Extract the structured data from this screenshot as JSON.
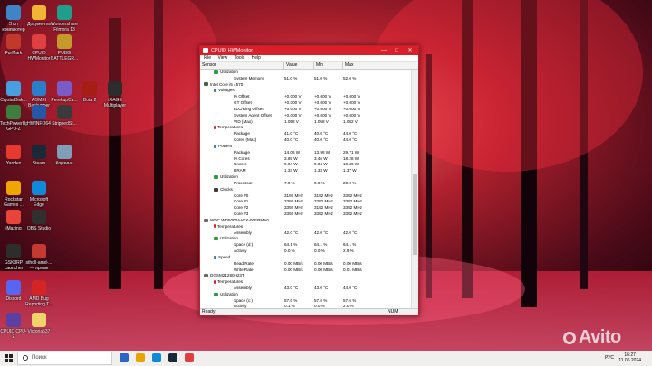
{
  "desktop_icons": [
    {
      "label": "Этот компьютер",
      "color": "#3d85c6"
    },
    {
      "label": "Документы",
      "color": "#f2b533"
    },
    {
      "label": "Wondershare Filmora 13",
      "color": "#1f9e8b"
    },
    {
      "label": "FurMark",
      "color": "#c0392b"
    },
    {
      "label": "CPUID HWMonitor",
      "color": "#e04040"
    },
    {
      "label": "PUBG BATTLEGR...",
      "color": "#c49a2b"
    },
    {
      "label": "CrystalDisk...",
      "color": "#46a0e0"
    },
    {
      "label": "AOMEI Backupper",
      "color": "#2a7fcc"
    },
    {
      "label": "PerekupCa...",
      "color": "#7b5cc7"
    },
    {
      "label": "Dota 2",
      "color": "#a61d16"
    },
    {
      "label": "tRAGE Multiplayer",
      "color": "#2d2d2d"
    },
    {
      "label": "TechPowerUp GPU-Z",
      "color": "#3e7d3e"
    },
    {
      "label": "HWINFO64",
      "color": "#2457a8"
    },
    {
      "label": "StrippedSt...",
      "color": "#3a3a3a"
    },
    {
      "label": "Yandex",
      "color": "#e63a2e"
    },
    {
      "label": "Steam",
      "color": "#1b2838"
    },
    {
      "label": "Корзина",
      "color": "#7f9eb8"
    },
    {
      "label": "Rockstar Games ...",
      "color": "#f0a500"
    },
    {
      "label": "Microsoft Edge",
      "color": "#0f8ad8"
    },
    {
      "label": "iMazing",
      "color": "#e8443a"
    },
    {
      "label": "OBS Studio",
      "color": "#303030"
    },
    {
      "label": "GSK3RP Launcher",
      "color": "#2d2d2d"
    },
    {
      "label": "sthqll-amd-... — ярлык",
      "color": "#c43a32"
    },
    {
      "label": "Discord",
      "color": "#5865f2"
    },
    {
      "label": "AMD Bug Reporting T...",
      "color": "#d42424"
    },
    {
      "label": "CPUID CPU-Z",
      "color": "#5c3fa3"
    },
    {
      "label": "Victoria537",
      "color": "#f1d36b"
    }
  ],
  "window": {
    "title": "CPUID HWMonitor",
    "minimize": "—",
    "maximize": "□",
    "close": "✕",
    "menu": [
      "File",
      "View",
      "Tools",
      "Help"
    ],
    "columns": [
      "Sensor",
      "Value",
      "Min",
      "Max"
    ],
    "rows": [
      {
        "indent": 1,
        "icon": "sensor",
        "name": "Utilization",
        "value": "",
        "min": "",
        "max": ""
      },
      {
        "indent": 3,
        "icon": "",
        "name": "System Memory",
        "value": "51.0 %",
        "min": "51.0 %",
        "max": "52.0 %"
      },
      {
        "indent": 0,
        "icon": "cpu",
        "name": "Intel Core i5 4570",
        "value": "",
        "min": "",
        "max": ""
      },
      {
        "indent": 1,
        "icon": "bolt",
        "name": "Voltages",
        "value": "",
        "min": "",
        "max": ""
      },
      {
        "indent": 3,
        "icon": "",
        "name": "IA Offset",
        "value": "+0.000 V",
        "min": "+0.000 V",
        "max": "+0.000 V"
      },
      {
        "indent": 3,
        "icon": "",
        "name": "GT Offset",
        "value": "+0.000 V",
        "min": "+0.000 V",
        "max": "+0.000 V"
      },
      {
        "indent": 3,
        "icon": "",
        "name": "LLC/Ring Offset",
        "value": "+0.000 V",
        "min": "+0.000 V",
        "max": "+0.000 V"
      },
      {
        "indent": 3,
        "icon": "",
        "name": "System Agent Offset",
        "value": "+0.000 V",
        "min": "+0.000 V",
        "max": "+0.000 V"
      },
      {
        "indent": 3,
        "icon": "",
        "name": "VID (Max)",
        "value": "1.058 V",
        "min": "1.058 V",
        "max": "1.082 V"
      },
      {
        "indent": 1,
        "icon": "therm",
        "name": "Temperatures",
        "value": "",
        "min": "",
        "max": ""
      },
      {
        "indent": 3,
        "icon": "",
        "name": "Package",
        "value": "41.0 °C",
        "min": "40.0 °C",
        "max": "44.0 °C"
      },
      {
        "indent": 3,
        "icon": "",
        "name": "Cores (Max)",
        "value": "40.0 °C",
        "min": "40.0 °C",
        "max": "44.0 °C"
      },
      {
        "indent": 1,
        "icon": "bolt",
        "name": "Powers",
        "value": "",
        "min": "",
        "max": ""
      },
      {
        "indent": 3,
        "icon": "",
        "name": "Package",
        "value": "14.06 W",
        "min": "13.98 W",
        "max": "29.71 W"
      },
      {
        "indent": 3,
        "icon": "",
        "name": "IA Cores",
        "value": "3.69 W",
        "min": "3.46 W",
        "max": "18.28 W"
      },
      {
        "indent": 3,
        "icon": "",
        "name": "Uncore",
        "value": "9.04 W",
        "min": "9.04 W",
        "max": "10.86 W"
      },
      {
        "indent": 3,
        "icon": "",
        "name": "DRAM",
        "value": "1.33 W",
        "min": "1.33 W",
        "max": "1.37 W"
      },
      {
        "indent": 1,
        "icon": "sensor",
        "name": "Utilization",
        "value": "",
        "min": "",
        "max": ""
      },
      {
        "indent": 3,
        "icon": "",
        "name": "Processor",
        "value": "7.0 %",
        "min": "0.0 %",
        "max": "20.0 %"
      },
      {
        "indent": 1,
        "icon": "grid",
        "name": "Clocks",
        "value": "",
        "min": "",
        "max": ""
      },
      {
        "indent": 3,
        "icon": "",
        "name": "Core #0",
        "value": "3192 MHz",
        "min": "3192 MHz",
        "max": "3392 MHz"
      },
      {
        "indent": 3,
        "icon": "",
        "name": "Core #1",
        "value": "3392 MHz",
        "min": "3392 MHz",
        "max": "3392 MHz"
      },
      {
        "indent": 3,
        "icon": "",
        "name": "Core #2",
        "value": "3392 MHz",
        "min": "3192 MHz",
        "max": "3392 MHz"
      },
      {
        "indent": 3,
        "icon": "",
        "name": "Core #3",
        "value": "3392 MHz",
        "min": "3392 MHz",
        "max": "3392 MHz"
      },
      {
        "indent": 0,
        "icon": "hdd",
        "name": "WDC WD5000AAKX-00ERMA0",
        "value": "",
        "min": "",
        "max": ""
      },
      {
        "indent": 1,
        "icon": "therm",
        "name": "Temperatures",
        "value": "",
        "min": "",
        "max": ""
      },
      {
        "indent": 3,
        "icon": "",
        "name": "Assembly",
        "value": "42.0 °C",
        "min": "42.0 °C",
        "max": "42.0 °C"
      },
      {
        "indent": 1,
        "icon": "sensor",
        "name": "Utilization",
        "value": "",
        "min": "",
        "max": ""
      },
      {
        "indent": 3,
        "icon": "",
        "name": "Space (d:)",
        "value": "64.1 %",
        "min": "64.1 %",
        "max": "64.1 %"
      },
      {
        "indent": 3,
        "icon": "",
        "name": "Activity",
        "value": "0.0 %",
        "min": "0.0 %",
        "max": "2.9 %"
      },
      {
        "indent": 1,
        "icon": "bolt",
        "name": "Speed",
        "value": "",
        "min": "",
        "max": ""
      },
      {
        "indent": 3,
        "icon": "",
        "name": "Read Rate",
        "value": "0.00 MB/s",
        "min": "0.00 MB/s",
        "max": "0.00 MB/s"
      },
      {
        "indent": 3,
        "icon": "",
        "name": "Write Rate",
        "value": "0.00 MB/s",
        "min": "0.00 MB/s",
        "max": "0.01 MB/s"
      },
      {
        "indent": 0,
        "icon": "hdd",
        "name": "DGSM21280H23T",
        "value": "",
        "min": "",
        "max": ""
      },
      {
        "indent": 1,
        "icon": "therm",
        "name": "Temperatures",
        "value": "",
        "min": "",
        "max": ""
      },
      {
        "indent": 3,
        "icon": "",
        "name": "Assembly",
        "value": "43.0 °C",
        "min": "43.0 °C",
        "max": "44.0 °C"
      },
      {
        "indent": 1,
        "icon": "sensor",
        "name": "Utilization",
        "value": "",
        "min": "",
        "max": ""
      },
      {
        "indent": 3,
        "icon": "",
        "name": "Space (c:)",
        "value": "57.6 %",
        "min": "57.6 %",
        "max": "57.6 %"
      },
      {
        "indent": 3,
        "icon": "",
        "name": "Activity",
        "value": "0.1 %",
        "min": "0.0 %",
        "max": "2.0 %"
      }
    ],
    "status_ready": "Ready",
    "status_num": "NUM"
  },
  "taskbar": {
    "search_placeholder": "Поиск",
    "language": "РУС",
    "time": "16:27",
    "date": "11.06.2024",
    "pinned_colors": [
      "#2d64c8",
      "#e8a400",
      "#0f8ad8",
      "#1b2838",
      "#e04040"
    ]
  },
  "watermark": "Avito"
}
